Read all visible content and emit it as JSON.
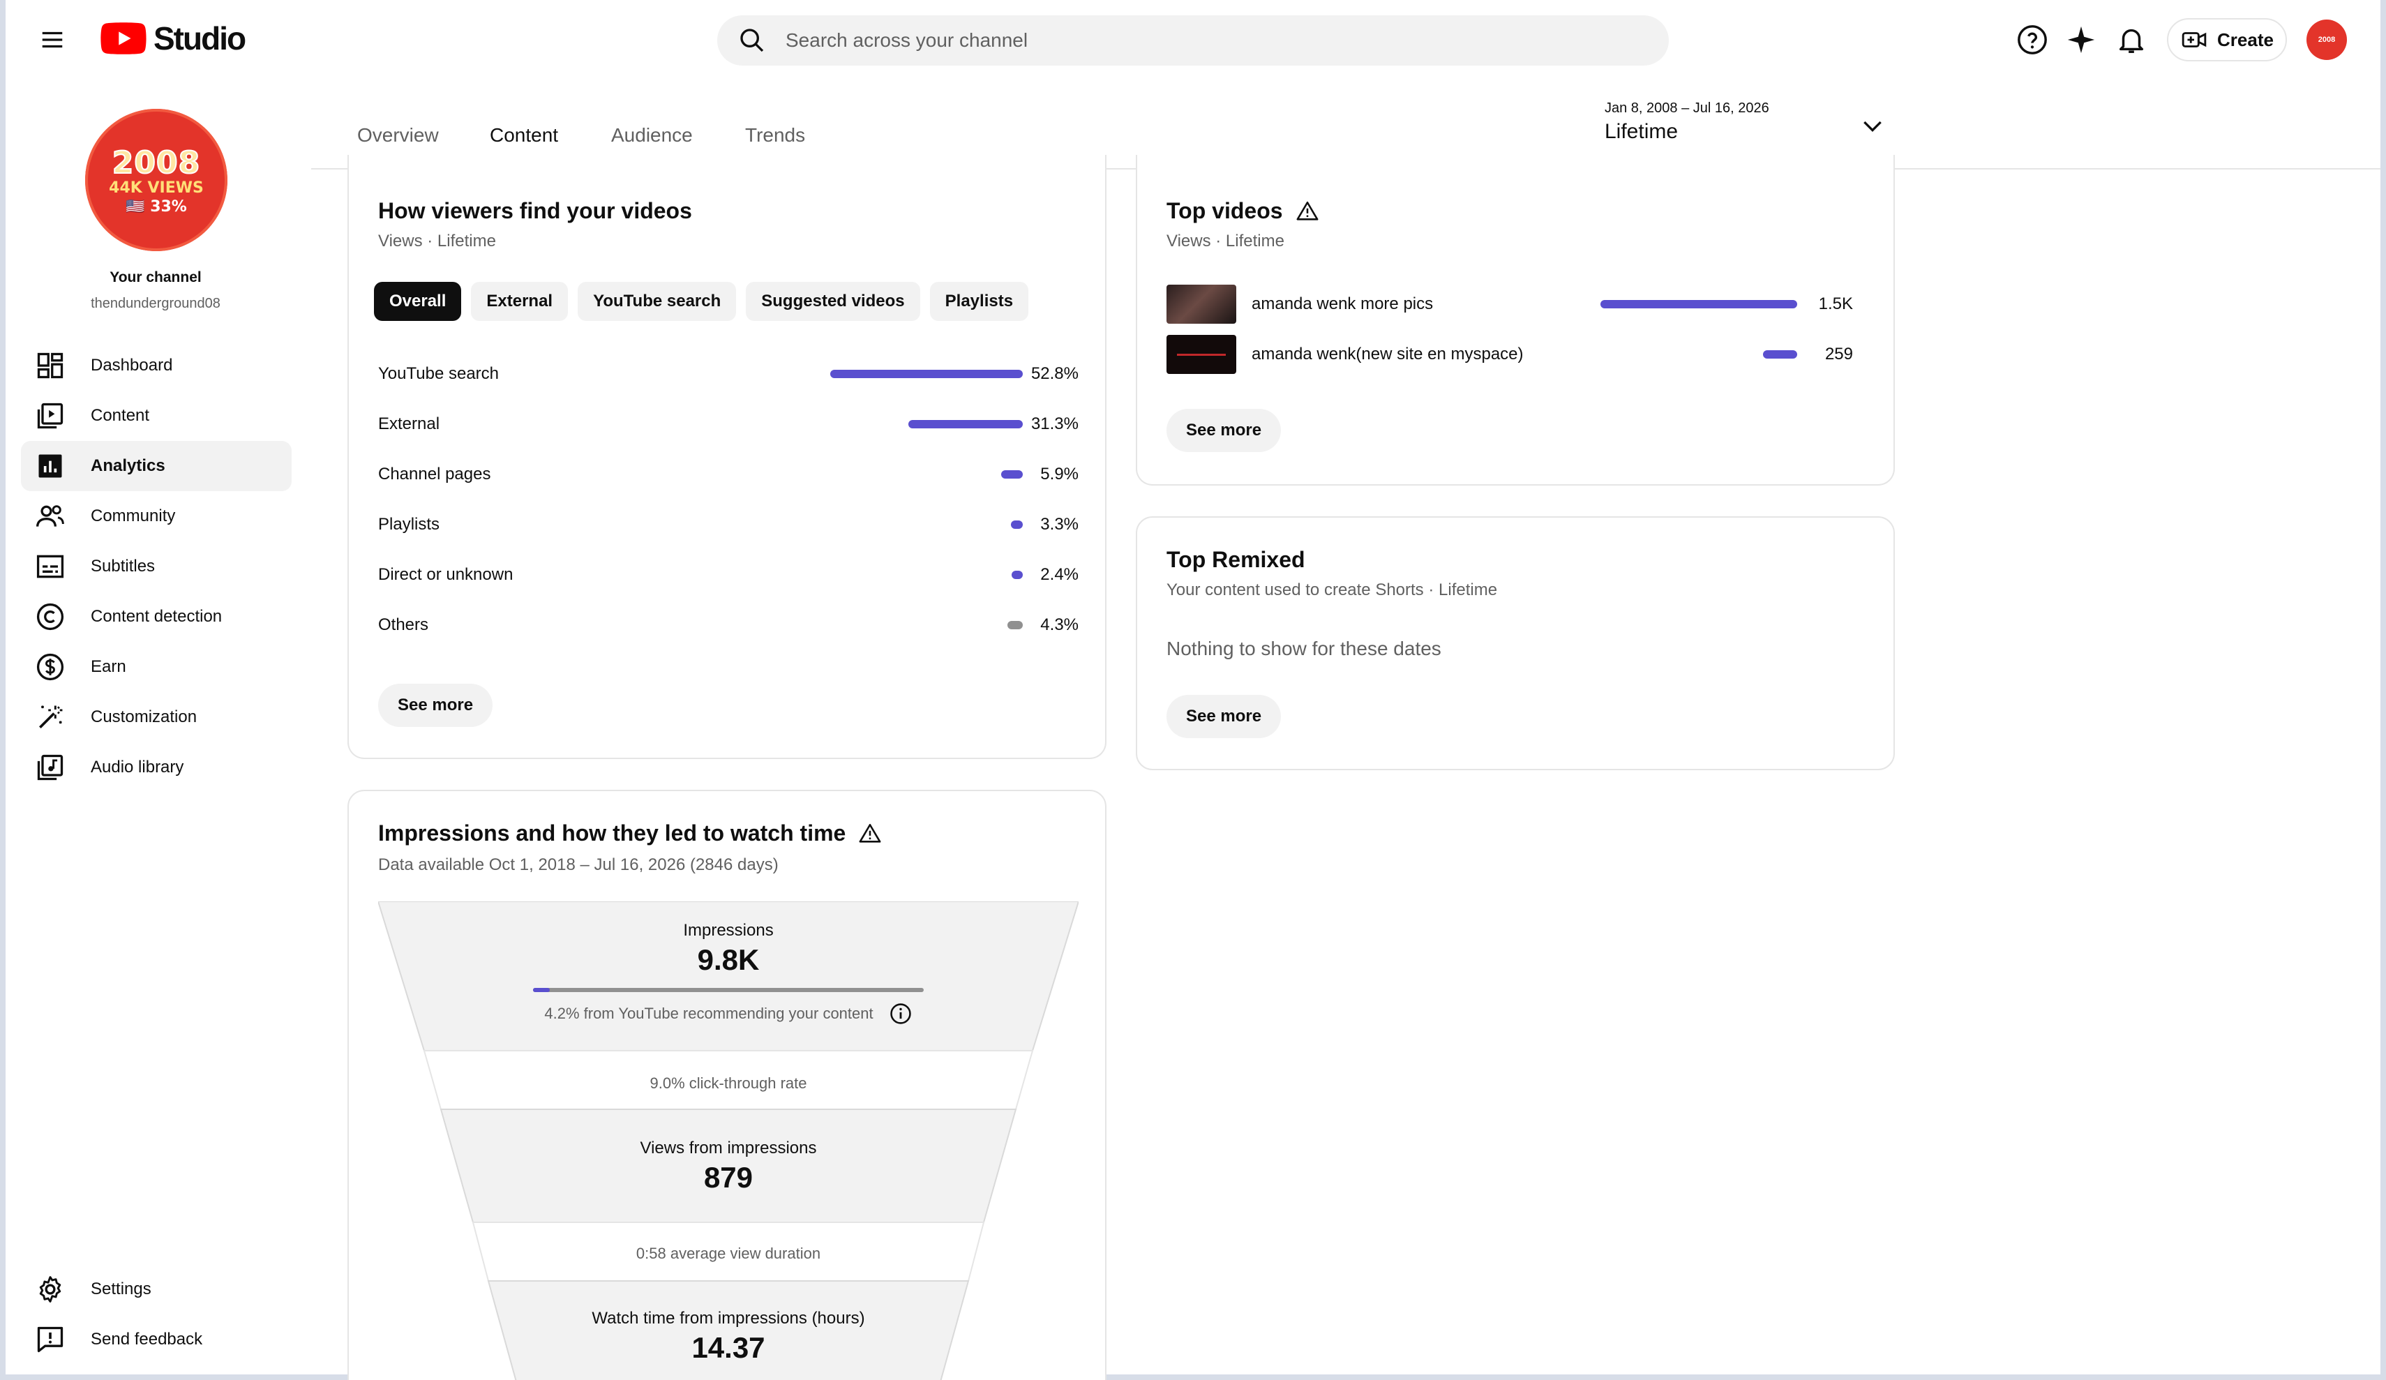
{
  "app": {
    "logo_text": "Studio",
    "search_placeholder": "Search across your channel",
    "create_label": "Create",
    "top_avatar_text": "2008"
  },
  "channel": {
    "avatar_year": "2008",
    "avatar_views": "44K VIEWS",
    "avatar_pct": "🇺🇸 33%",
    "title": "Your channel",
    "handle": "thendunderground08"
  },
  "sidebar": {
    "items": [
      {
        "label": "Dashboard",
        "icon": "dashboard-icon"
      },
      {
        "label": "Content",
        "icon": "content-icon"
      },
      {
        "label": "Analytics",
        "icon": "analytics-icon",
        "active": true
      },
      {
        "label": "Community",
        "icon": "community-icon"
      },
      {
        "label": "Subtitles",
        "icon": "subtitles-icon"
      },
      {
        "label": "Content detection",
        "icon": "copyright-icon"
      },
      {
        "label": "Earn",
        "icon": "earn-icon"
      },
      {
        "label": "Customization",
        "icon": "customization-icon"
      },
      {
        "label": "Audio library",
        "icon": "audio-library-icon"
      }
    ],
    "bottom": [
      {
        "label": "Settings",
        "icon": "settings-icon"
      },
      {
        "label": "Send feedback",
        "icon": "feedback-icon"
      }
    ]
  },
  "tabs": [
    {
      "label": "Overview"
    },
    {
      "label": "Content",
      "active": true
    },
    {
      "label": "Audience"
    },
    {
      "label": "Trends"
    }
  ],
  "date_range": {
    "range": "Jan 8, 2008 – Jul 16, 2026",
    "label": "Lifetime"
  },
  "traffic": {
    "title": "How viewers find your videos",
    "subtitle": "Views · Lifetime",
    "chips": [
      "Overall",
      "External",
      "YouTube search",
      "Suggested videos",
      "Playlists"
    ],
    "active_chip": "Overall",
    "sources": [
      {
        "label": "YouTube search",
        "pct": "52.8%",
        "value": 52.8
      },
      {
        "label": "External",
        "pct": "31.3%",
        "value": 31.3
      },
      {
        "label": "Channel pages",
        "pct": "5.9%",
        "value": 5.9
      },
      {
        "label": "Playlists",
        "pct": "3.3%",
        "value": 3.3
      },
      {
        "label": "Direct or unknown",
        "pct": "2.4%",
        "value": 2.4
      },
      {
        "label": "Others",
        "pct": "4.3%",
        "value": 4.3,
        "grey": true
      }
    ],
    "see_more": "See more"
  },
  "impressions": {
    "title": "Impressions and how they led to watch time",
    "subtitle": "Data available Oct 1, 2018 – Jul 16, 2026 (2846 days)",
    "impressions_label": "Impressions",
    "impressions_value": "9.8K",
    "recommend_note": "4.2% from YouTube recommending your content",
    "recommend_fraction": 0.042,
    "ctr_note": "9.0% click-through rate",
    "views_label": "Views from impressions",
    "views_value": "879",
    "avd_note": "0:58 average view duration",
    "watch_label": "Watch time from impressions (hours)",
    "watch_value": "14.37"
  },
  "top_videos": {
    "title": "Top videos",
    "subtitle": "Views · Lifetime",
    "videos": [
      {
        "title": "amanda wenk more pics",
        "views": "1.5K",
        "value": 1500
      },
      {
        "title": "amanda wenk(new site en myspace)",
        "views": "259",
        "value": 259
      }
    ],
    "see_more": "See more"
  },
  "top_remixed": {
    "title": "Top Remixed",
    "subtitle": "Your content used to create Shorts · Lifetime",
    "empty": "Nothing to show for these dates",
    "see_more": "See more"
  },
  "colors": {
    "accent_bar": "#5a4fcf",
    "brand_red": "#ff0000",
    "avatar_red": "#e3342a"
  }
}
